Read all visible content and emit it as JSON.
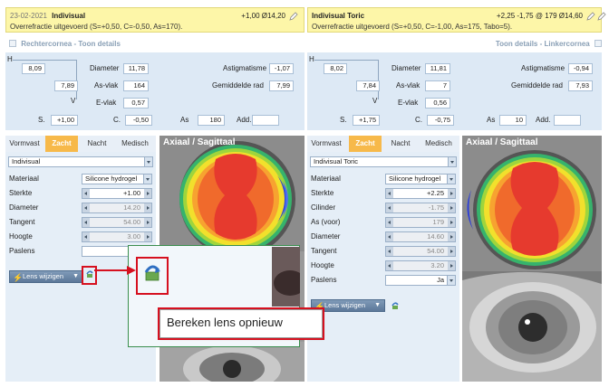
{
  "left": {
    "header": {
      "date": "23-02-2021",
      "lens": "Indivisual",
      "value": "+1,00 Ø14,20",
      "summary": "Overrefractie uitgevoerd (S=+0,50, C=-0,50, As=170)."
    },
    "cornea_title": "Rechtercornea",
    "details_link": "Toon details",
    "separator": " - ",
    "k": {
      "h_label": "H",
      "v_label": "V",
      "h_value": "8,09",
      "v_value": "7,89",
      "diameter_label": "Diameter",
      "diameter": "11,78",
      "asvlak_label": "As-vlak",
      "asvlak": "164",
      "evlak_label": "E-vlak",
      "evlak": "0,57",
      "astig_label": "Astigmatisme",
      "astig": "-1,07",
      "gemrad_label": "Gemiddelde rad",
      "gemrad": "7,99"
    },
    "refraction": {
      "s_label": "S.",
      "s": "+1,00",
      "c_label": "C.",
      "c": "-0,50",
      "as_label": "As",
      "as": "180",
      "add_label": "Add.",
      "add": ""
    },
    "tabs": [
      "Vormvast",
      "Zacht",
      "Nacht",
      "Medisch"
    ],
    "active_tab": "Zacht",
    "lens_select": "Indivisual",
    "params": [
      {
        "label": "Materiaal",
        "type": "select",
        "value": "Silicone hydrogel"
      },
      {
        "label": "Sterkte",
        "type": "spin",
        "value": "+1.00",
        "disabled": false
      },
      {
        "label": "Diameter",
        "type": "spin",
        "value": "14.20",
        "disabled": true
      },
      {
        "label": "Tangent",
        "type": "spin",
        "value": "54.00",
        "disabled": true
      },
      {
        "label": "Hoogte",
        "type": "spin",
        "value": "3.00",
        "disabled": true
      },
      {
        "label": "Paslens",
        "type": "select",
        "value": ""
      }
    ],
    "lens_button": "Lens wijzigen",
    "map_title": "Axiaal / Sagittaal"
  },
  "right": {
    "header": {
      "lens": "Indivisual Toric",
      "value": "+2,25 -1,75 @ 179 Ø14,60",
      "summary": "Overrefractie uitgevoerd (S=+0,50, C=-1,00, As=175, Tabo=5)."
    },
    "cornea_title": "Linkercornea",
    "details_link": "Toon details",
    "separator": " - ",
    "k": {
      "h_label": "H",
      "v_label": "V",
      "h_value": "8,02",
      "v_value": "7,84",
      "diameter_label": "Diameter",
      "diameter": "11,81",
      "asvlak_label": "As-vlak",
      "asvlak": "7",
      "evlak_label": "E-vlak",
      "evlak": "0,56",
      "astig_label": "Astigmatisme",
      "astig": "-0,94",
      "gemrad_label": "Gemiddelde rad",
      "gemrad": "7,93"
    },
    "refraction": {
      "s_label": "S.",
      "s": "+1,75",
      "c_label": "C.",
      "c": "-0,75",
      "as_label": "As",
      "as": "10",
      "add_label": "Add.",
      "add": ""
    },
    "tabs": [
      "Vormvast",
      "Zacht",
      "Nacht",
      "Medisch"
    ],
    "active_tab": "Zacht",
    "lens_select": "Indivisual Toric",
    "params": [
      {
        "label": "Materiaal",
        "type": "select",
        "value": "Silicone hydrogel"
      },
      {
        "label": "Sterkte",
        "type": "spin",
        "value": "+2.25",
        "disabled": false
      },
      {
        "label": "Cilinder",
        "type": "spin",
        "value": "-1.75",
        "disabled": true
      },
      {
        "label": "As (voor)",
        "type": "spin",
        "value": "179",
        "disabled": true
      },
      {
        "label": "Diameter",
        "type": "spin",
        "value": "14.60",
        "disabled": true
      },
      {
        "label": "Tangent",
        "type": "spin",
        "value": "54.00",
        "disabled": true
      },
      {
        "label": "Hoogte",
        "type": "spin",
        "value": "3.20",
        "disabled": true
      },
      {
        "label": "Paslens",
        "type": "select",
        "value": "Ja"
      }
    ],
    "lens_button": "Lens wijzigen",
    "map_title": "Axiaal / Sagittaal"
  },
  "callout": {
    "tooltip": "Bereken lens opnieuw"
  },
  "icons": [
    "pencil-icon",
    "recalculate-icon",
    "lightning-icon",
    "chevron-down-icon",
    "checkbox-icon"
  ],
  "colors": {
    "header_bg": "#fdf6a8",
    "panel_bg": "#dde9f5",
    "active_tab": "#f7b94a",
    "highlight_red": "#d6101f",
    "callout_border": "#3a8e4d"
  }
}
